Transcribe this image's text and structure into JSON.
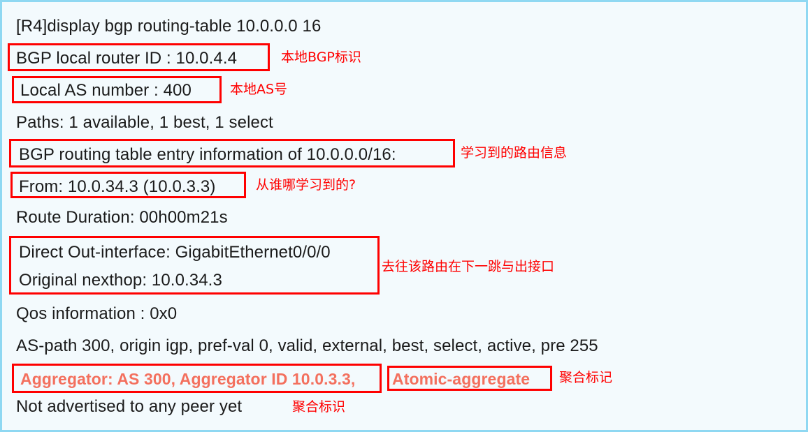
{
  "terminal": {
    "background_color": "#f3fafd",
    "border_color": "#8fd8f2",
    "text_color": "#1b1b1b",
    "annotation_color": "#ff0000",
    "highlight_box_color": "#ff0000",
    "aggregator_text_color": "#f3705e",
    "lines": {
      "command": "[R4]display bgp routing-table 10.0.0.0 16",
      "router_id": "BGP local router ID : 10.0.4.4",
      "local_as": "Local AS number : 400",
      "paths": "Paths:   1 available, 1 best, 1 select",
      "entry_info": "BGP routing table entry information of 10.0.0.0/16:",
      "from": "From: 10.0.34.3 (10.0.3.3)",
      "route_duration": "Route Duration: 00h00m21s",
      "out_interface": "Direct Out-interface: GigabitEthernet0/0/0",
      "original_nexthop": "Original nexthop: 10.0.34.3",
      "qos": "Qos information : 0x0",
      "as_path": "AS-path 300, origin igp, pref-val 0, valid, external, best, select, active, pre 255",
      "aggregator": "Aggregator: AS 300, Aggregator ID 10.0.3.3,",
      "atomic_aggregate": "Atomic-aggregate",
      "not_advertised": "Not advertised to any peer yet"
    }
  },
  "annotations": {
    "router_id_note": "本地BGP标识",
    "local_as_note": "本地AS号",
    "entry_info_note": "学习到的路由信息",
    "from_note": "从谁哪学习到的?",
    "out_interface_note": "去往该路由在下一跳与出接口",
    "atomic_note": "聚合标记",
    "not_advertised_note": "聚合标识"
  }
}
